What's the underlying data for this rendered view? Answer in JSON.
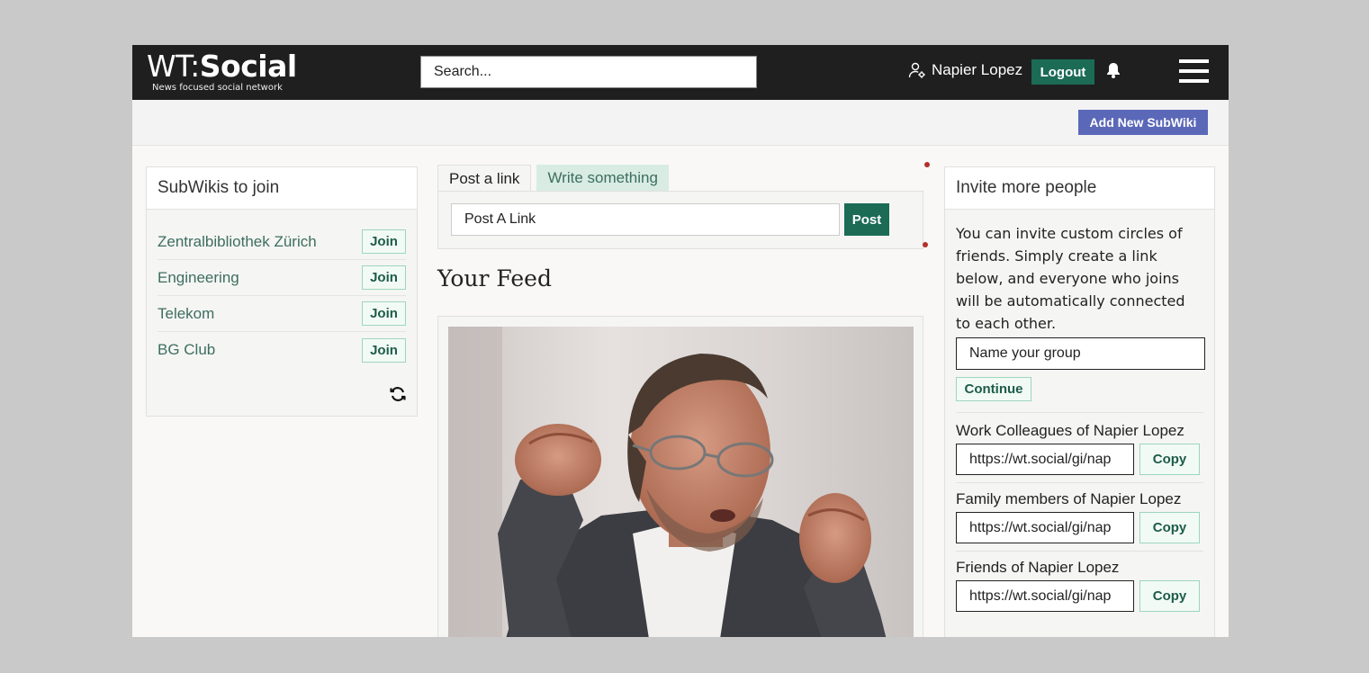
{
  "header": {
    "logo_wt": "WT:",
    "logo_social": "Social",
    "logo_tagline": "News focused social network",
    "search_placeholder": "Search...",
    "user_name": "Napier Lopez",
    "logout_label": "Logout"
  },
  "subheader": {
    "add_subwiki_label": "Add New SubWiki"
  },
  "left": {
    "title": "SubWikis to join",
    "join_label": "Join",
    "items": [
      {
        "name": "Zentralbibliothek Zürich"
      },
      {
        "name": "Engineering"
      },
      {
        "name": "Telekom"
      },
      {
        "name": "BG Club"
      }
    ]
  },
  "center": {
    "tabs": [
      {
        "label": "Post a link"
      },
      {
        "label": "Write something"
      }
    ],
    "link_placeholder": "Post A Link",
    "post_label": "Post",
    "feed_title": "Your Feed"
  },
  "right": {
    "title": "Invite more people",
    "description": "You can invite custom circles of friends. Simply create a link below, and everyone who joins will be automatically connected to each other.",
    "group_placeholder": "Name your group",
    "continue_label": "Continue",
    "copy_label": "Copy",
    "circles": [
      {
        "label": "Work Colleagues of Napier Lopez",
        "url": "https://wt.social/gi/nap"
      },
      {
        "label": "Family members of Napier Lopez",
        "url": "https://wt.social/gi/nap"
      },
      {
        "label": "Friends of Napier Lopez",
        "url": "https://wt.social/gi/nap"
      }
    ]
  },
  "colors": {
    "accent_green": "#1b6b55",
    "accent_blue": "#5b68b8",
    "header_bg": "#1f1f1f"
  }
}
